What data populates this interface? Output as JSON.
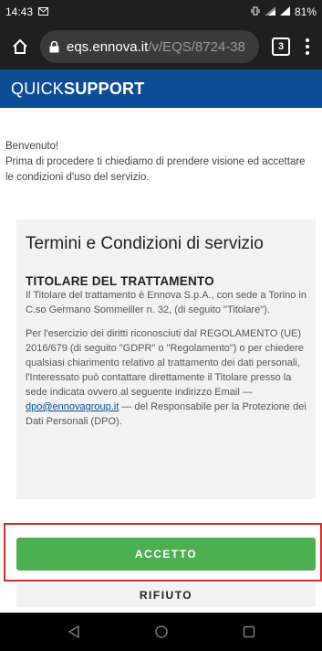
{
  "status_bar": {
    "time": "14:43",
    "battery": "81%"
  },
  "browser": {
    "url_host": "eqs.ennova.it",
    "url_path": "/v/EQS/8724-38",
    "tab_count": "3"
  },
  "app_header": {
    "brand_thin": "QUICK",
    "brand_bold": "SUPPORT"
  },
  "welcome": {
    "line1": "Benvenuto!",
    "line2": "Prima di procedere ti chiediamo di prendere visione ed accettare le condizioni d'uso del servizio."
  },
  "terms": {
    "title": "Termini e Condizioni di servizio",
    "section_title": "TITOLARE DEL TRATTAMENTO",
    "paragraph1": "Il Titolare del trattamento è Ennova S.p.A., con sede a Torino in C.so Germano Sommeiller n. 32, (di seguito \"Titolare\").",
    "paragraph2_start": "Per l'esercizio dei diritti riconosciuti dal REGOLAMENTO (UE) 2016/679 (di seguito \"GDPR\" o \"Regolamento\") o per chiedere qualsiasi chiarimento relativo al trattamento dei dati personali, l'Interessato può contattare direttamente il Titolare presso la sede indicata ovvero al seguente indirizzo Email — ",
    "email": "dpo@ennovagroup.it",
    "paragraph2_end": " — del Responsabile per la Protezione dei Dati Personali (DPO)."
  },
  "actions": {
    "accept_label": "ACCETTO",
    "refuse_label": "RIFIUTO"
  },
  "colors": {
    "header_blue": "#0d4d97",
    "accept_green": "#4caf50",
    "highlight_red": "#d62b2b"
  }
}
